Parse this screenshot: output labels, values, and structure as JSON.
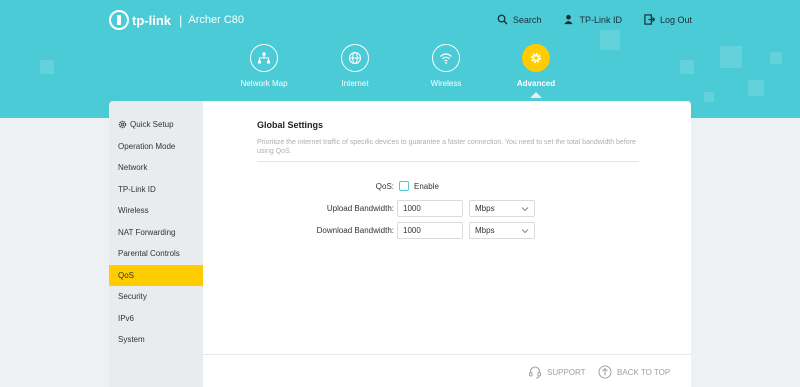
{
  "header": {
    "brand": "tp-link",
    "separator": "|",
    "model": "Archer C80",
    "links": [
      {
        "label": "Search",
        "icon": "search-icon"
      },
      {
        "label": "TP-Link ID",
        "icon": "user-icon"
      },
      {
        "label": "Log Out",
        "icon": "logout-icon"
      }
    ],
    "bg_color": "#4acbd6",
    "accent_color": "#ffcc00"
  },
  "nav": {
    "items": [
      {
        "label": "Network Map",
        "icon": "network-map-icon"
      },
      {
        "label": "Internet",
        "icon": "globe-icon"
      },
      {
        "label": "Wireless",
        "icon": "wifi-icon"
      },
      {
        "label": "Advanced",
        "icon": "gear-icon",
        "active": true
      }
    ]
  },
  "sidebar": {
    "items": [
      {
        "label": "Quick Setup",
        "icon": "gear-icon"
      },
      {
        "label": "Operation Mode"
      },
      {
        "label": "Network"
      },
      {
        "label": "TP-Link ID"
      },
      {
        "label": "Wireless"
      },
      {
        "label": "NAT Forwarding"
      },
      {
        "label": "Parental Controls"
      },
      {
        "label": "QoS",
        "active": true
      },
      {
        "label": "Security"
      },
      {
        "label": "IPv6"
      },
      {
        "label": "System"
      }
    ]
  },
  "main": {
    "title": "Global Settings",
    "description": "Prioritize the internet traffic of specific devices to guarantee a faster connection. You need to set the total bandwidth before using QoS.",
    "qos": {
      "label": "QoS:",
      "checkbox_label": "Enable",
      "checked": false
    },
    "upload": {
      "label": "Upload Bandwidth:",
      "value": "1000",
      "unit": "Mbps"
    },
    "download": {
      "label": "Download Bandwidth:",
      "value": "1000",
      "unit": "Mbps"
    }
  },
  "footer": {
    "support": "SUPPORT",
    "back_to_top": "BACK TO TOP"
  }
}
